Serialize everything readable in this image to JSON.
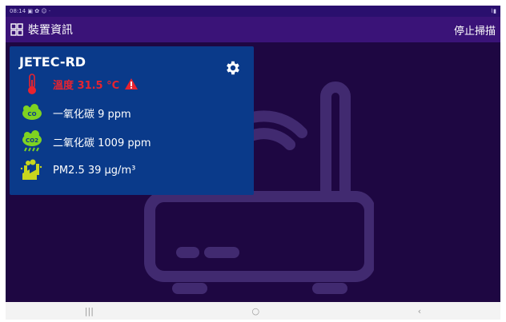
{
  "status_bar": {
    "time_icons": "08:14 ▣ ✿ ☺ ·",
    "right": "⌇▮"
  },
  "app_bar": {
    "title": "裝置資訊",
    "action": "停止掃描"
  },
  "device": {
    "name": "JETEC-RD",
    "temperature": "溫度 31.5 °C",
    "co": "一氧化碳 9 ppm",
    "co2": "二氧化碳 1009 ppm",
    "pm25": "PM2.5  39 μg/m³",
    "co_icon_label": "CO",
    "co2_icon_label": "CO2"
  },
  "nav_bar": {
    "recents": "|||",
    "home": "○",
    "back": "‹"
  },
  "colors": {
    "accent": "#3a1378",
    "card": "#0a3a8a",
    "background": "#1e0742",
    "warning": "#e8232f",
    "sensor_green": "#7ed321"
  }
}
